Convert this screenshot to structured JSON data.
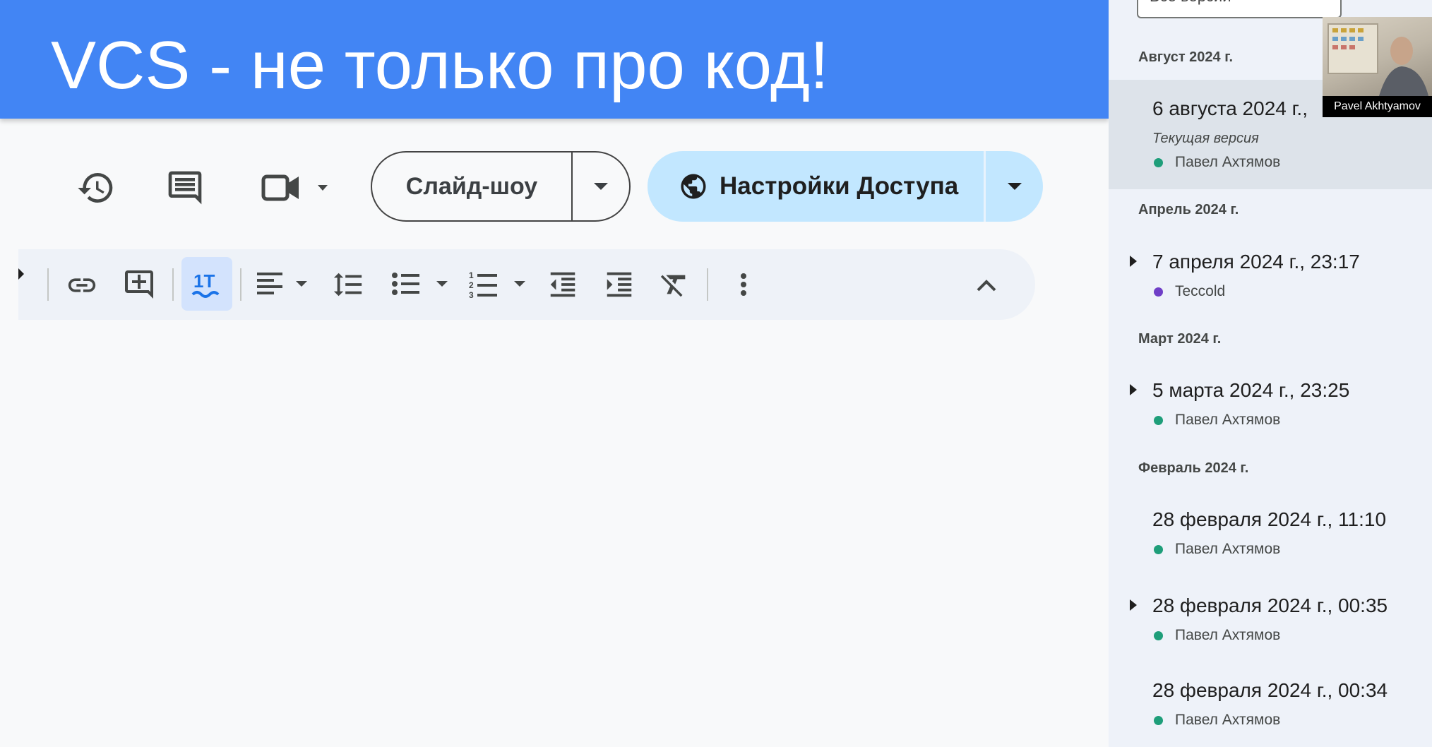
{
  "slide": {
    "title": "VCS - не только про код!"
  },
  "toolbar": {
    "history_icon": "history-icon",
    "comments_icon": "comment-icon",
    "meet_icon": "video-camera-icon",
    "slideshow_label": "Слайд-шоу",
    "share_label": "Настройки Доступа"
  },
  "format_toolbar": {
    "items": [
      "link-icon",
      "add-comment-icon",
      "highlight-text-icon",
      "align-left-icon",
      "line-spacing-icon",
      "bulleted-list-icon",
      "numbered-list-icon",
      "decrease-indent-icon",
      "increase-indent-icon",
      "clear-formatting-icon",
      "more-vert-icon",
      "chevron-up-icon"
    ]
  },
  "version_panel": {
    "filter_label": "Все версии",
    "groups": [
      {
        "month": "Август 2024 г.",
        "versions": [
          {
            "title": "6 августа 2024 г., ",
            "subtitle": "Текущая версия",
            "author": "Павел Ахтямов",
            "author_color": "#1e9e7a"
          }
        ]
      },
      {
        "month": "Апрель 2024 г.",
        "versions": [
          {
            "title": "7 апреля 2024 г., 23:17",
            "author": "Teccold",
            "author_color": "#6f3fc7"
          }
        ]
      },
      {
        "month": "Март 2024 г.",
        "versions": [
          {
            "title": "5 марта 2024 г., 23:25",
            "author": "Павел Ахтямов",
            "author_color": "#1e9e7a"
          }
        ]
      },
      {
        "month": "Февраль 2024 г.",
        "versions": [
          {
            "title": "28 февраля 2024 г., 11:10",
            "author": "Павел Ахтямов",
            "author_color": "#1e9e7a"
          },
          {
            "title": "28 февраля 2024 г., 00:35",
            "author": "Павел Ахтямов",
            "author_color": "#1e9e7a"
          },
          {
            "title": "28 февраля 2024 г., 00:34",
            "author": "Павел Ахтямов",
            "author_color": "#1e9e7a"
          }
        ]
      }
    ]
  },
  "webcam": {
    "name": "Pavel Akhtyamov"
  },
  "colors": {
    "banner": "#4285f4",
    "share_button": "#c2e7ff",
    "highlight_active": "#d3e3fd",
    "panel_bg": "#eef2f9"
  }
}
